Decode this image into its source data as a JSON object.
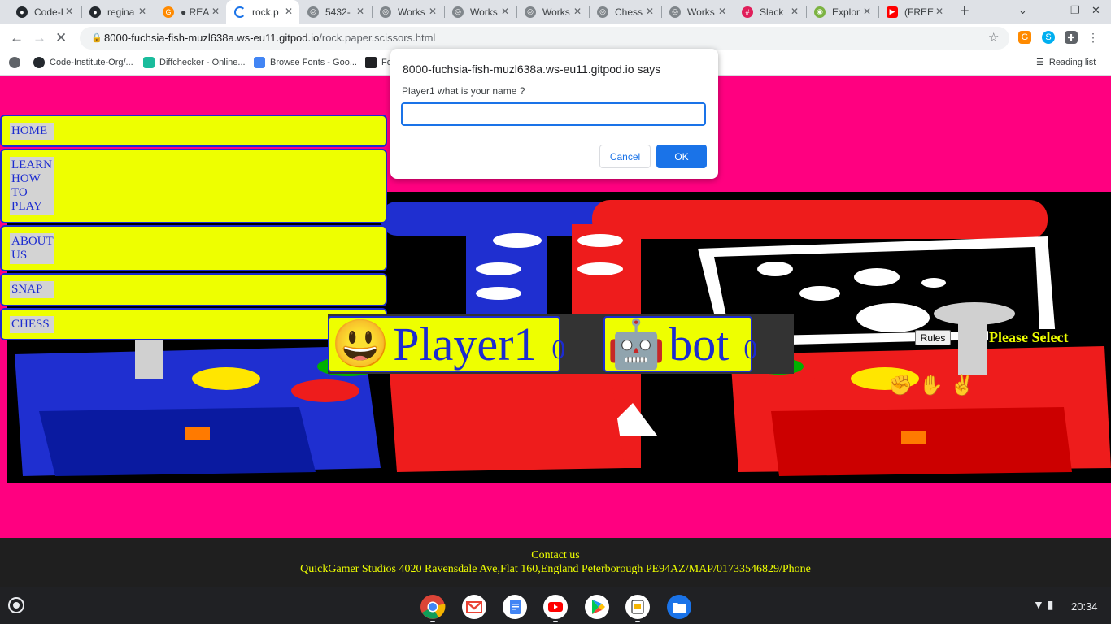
{
  "browser": {
    "tabs": [
      {
        "title": "Code-I",
        "icon": "github-icon"
      },
      {
        "title": "regina",
        "icon": "github-icon"
      },
      {
        "title": "● REA",
        "icon": "gitpod-icon"
      },
      {
        "title": "rock.p",
        "icon": "loading-icon"
      },
      {
        "title": "5432-",
        "icon": "globe-icon"
      },
      {
        "title": "Works",
        "icon": "globe-icon"
      },
      {
        "title": "Works",
        "icon": "globe-icon"
      },
      {
        "title": "Works",
        "icon": "globe-icon"
      },
      {
        "title": "Chess",
        "icon": "globe-icon"
      },
      {
        "title": "Works",
        "icon": "globe-icon"
      },
      {
        "title": "Slack",
        "icon": "slack-icon"
      },
      {
        "title": "Explor",
        "icon": "explore-icon"
      },
      {
        "title": "(FREE",
        "icon": "youtube-icon"
      }
    ],
    "url_host": "8000-fuchsia-fish-muzl638a.ws-eu11.gitpod.io",
    "url_path": "/rock.paper.scissors.html",
    "bookmarks": [
      {
        "label": "Code-Institute-Org/..."
      },
      {
        "label": "Diffchecker - Online..."
      },
      {
        "label": "Browse Fonts - Goo..."
      },
      {
        "label": "Fo"
      }
    ],
    "reading_list": "Reading list"
  },
  "dialog": {
    "title": "8000-fuchsia-fish-muzl638a.ws-eu11.gitpod.io says",
    "message": "Player1 what is your name ?",
    "input_value": "",
    "cancel_label": "Cancel",
    "ok_label": "OK"
  },
  "nav": {
    "items": [
      "HOME",
      "LEARN HOW TO PLAY",
      "ABOUT US",
      "SNAP",
      "CHESS"
    ]
  },
  "game": {
    "player": {
      "face": "😃",
      "name": "Player1",
      "score": "0"
    },
    "bot": {
      "face": "🤖",
      "name": "bot",
      "score": "0"
    },
    "rules_label": "Rules",
    "prompt": "Please Select",
    "choices": [
      "✊",
      "✋",
      "✌"
    ]
  },
  "footer": {
    "line1": "Contact us",
    "line2": "QuickGamer Studios 4020 Ravensdale Ave,Flat 160,England Peterborough PE94AZ/MAP/01733546829/Phone"
  },
  "system": {
    "time": "20:34",
    "shelf_apps": [
      "chrome-icon",
      "gmail-icon",
      "docs-icon",
      "youtube-icon",
      "play-store-icon",
      "slides-icon",
      "files-icon"
    ]
  }
}
